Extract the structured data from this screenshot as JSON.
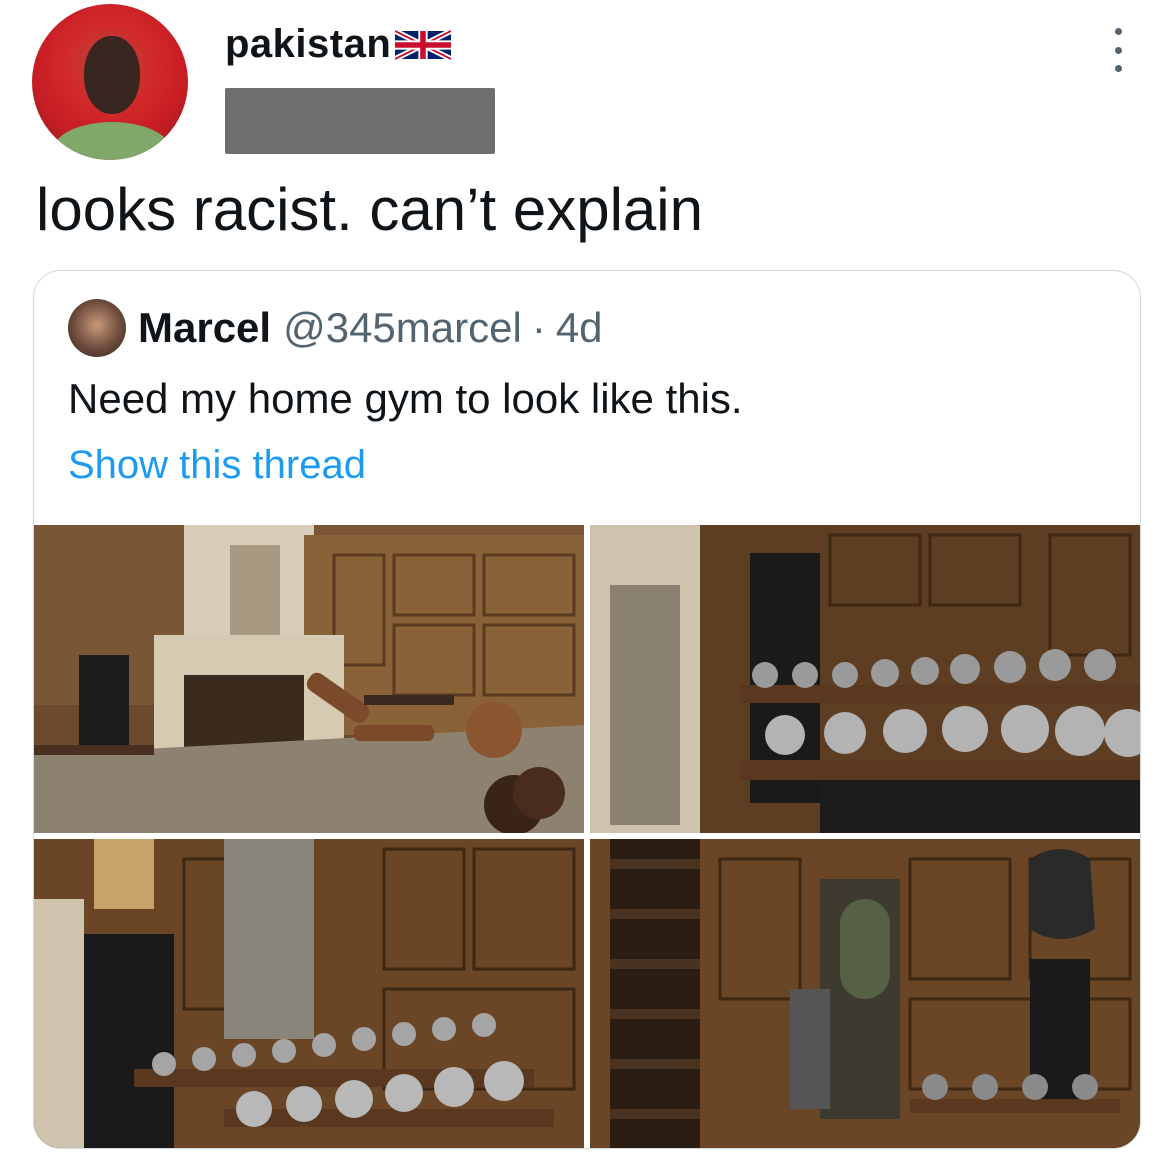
{
  "tweet": {
    "username": "pakistan",
    "username_flag_icon": "uk-flag-icon",
    "text": "looks racist. can’t explain",
    "more_icon": "more-options-icon"
  },
  "quoted_tweet": {
    "name": "Marcel",
    "handle": "@345marcel",
    "separator": "·",
    "time": "4d",
    "text": "Need my home gym to look like this.",
    "show_thread": "Show this thread",
    "photos": [
      "gym-photo-1",
      "gym-photo-2",
      "gym-photo-3",
      "gym-photo-4"
    ]
  },
  "colors": {
    "link": "#1d9bf0",
    "secondary_text": "#536471",
    "border": "#cfd9de",
    "redaction": "#6f6f72"
  }
}
